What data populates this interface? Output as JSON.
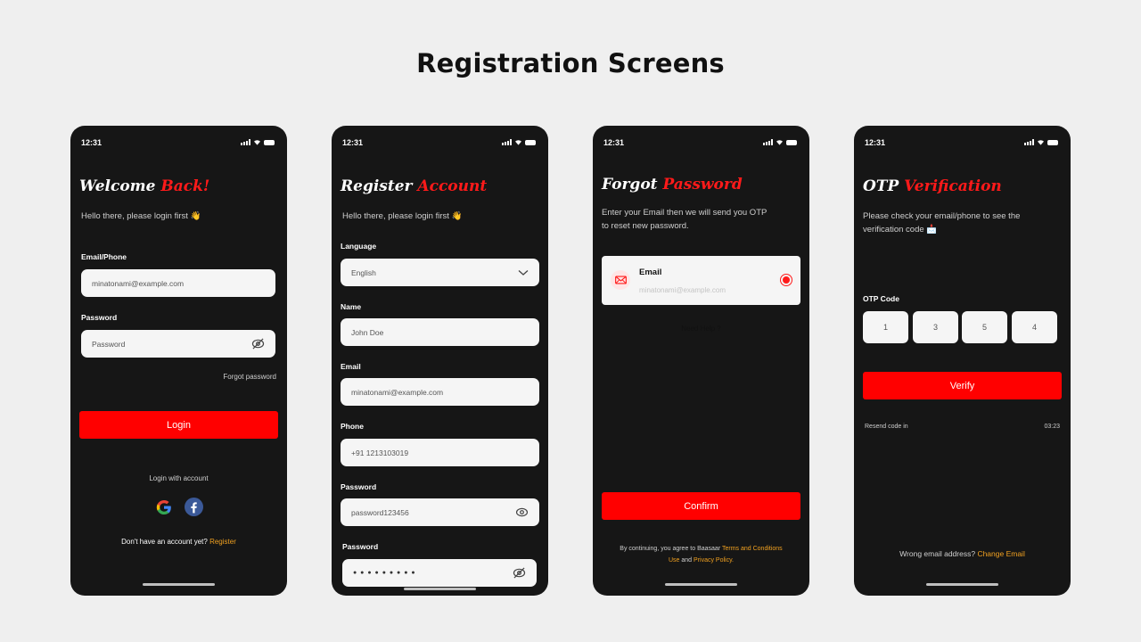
{
  "page_title": "Registration Screens",
  "status_time": "12:31",
  "login": {
    "heading_white": "Welcome",
    "heading_red": "Back!",
    "subtitle": "Hello there, please login first 👋",
    "email_label": "Email/Phone",
    "email_value": "minatonami@example.com",
    "password_label": "Password",
    "password_placeholder": "Password",
    "forgot": "Forgot password",
    "login_button": "Login",
    "login_with": "Login with account",
    "no_account": "Don't have an account yet?",
    "register_link": "Register"
  },
  "register": {
    "heading_white": "Register",
    "heading_red": "Account",
    "subtitle": "Hello there, please login first 👋",
    "language_label": "Language",
    "language_value": "English",
    "name_label": "Name",
    "name_value": "John Doe",
    "email_label": "Email",
    "email_value": "minatonami@example.com",
    "phone_label": "Phone",
    "phone_value": "+91 1213103019",
    "password_label": "Password",
    "password_value": "password123456",
    "password2_label": "Password",
    "password2_value": "● ● ● ● ● ● ● ● ●"
  },
  "forgot": {
    "heading_white": "Forgot",
    "heading_red": "Password",
    "subtitle_1": "Enter your Email then we will send you OTP",
    "subtitle_2": "to reset new password.",
    "option_title": "Email",
    "option_value": "minatonami@example.com",
    "need_help": "Need Help ?",
    "confirm_button": "Confirm",
    "terms_prefix": "By continuing, you agree to Baasaar",
    "terms_link": "Terms and Conditions",
    "terms_link2": "Use",
    "terms_and": "and",
    "privacy_link": "Privacy Policy."
  },
  "otp": {
    "heading_white": "OTP",
    "heading_red": "Verification",
    "subtitle_1": "Please check your email/phone to see the",
    "subtitle_2": "verification code 📩",
    "otp_label": "OTP Code",
    "digits": [
      "1",
      "3",
      "5",
      "4"
    ],
    "verify_button": "Verify",
    "resend_label": "Resend code in",
    "resend_timer": "03:23",
    "wrong_email": "Wrong email address?",
    "change_email": "Change Email"
  }
}
